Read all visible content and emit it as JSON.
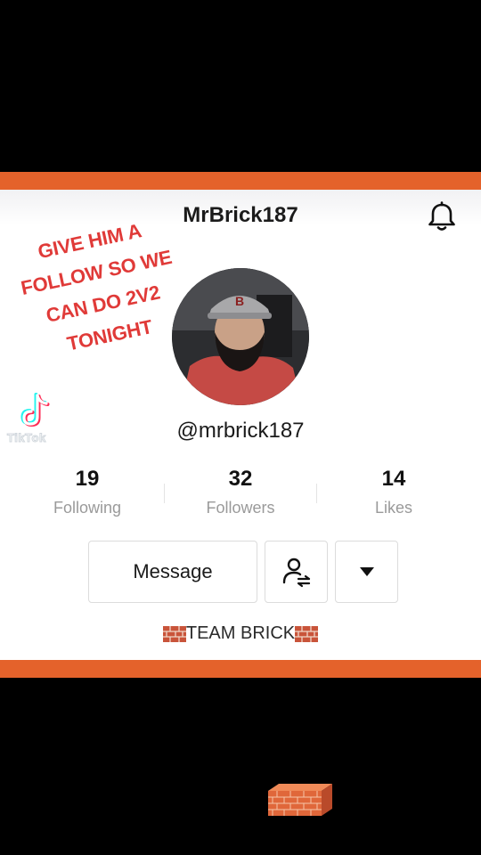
{
  "profile": {
    "username": "MrBrick187",
    "handle": "@mrbrick187",
    "bio": "TEAM BRICK"
  },
  "overlay": {
    "lines": [
      "GIVE HIM A",
      "FOLLOW SO WE",
      "CAN DO 2V2",
      "TONIGHT"
    ],
    "watermark": "TikTok"
  },
  "stats": [
    {
      "value": "19",
      "label": "Following"
    },
    {
      "value": "32",
      "label": "Followers"
    },
    {
      "value": "14",
      "label": "Likes"
    }
  ],
  "actions": {
    "message_label": "Message"
  },
  "icons": {
    "bell": "bell-icon",
    "follow": "user-swap-icon",
    "dropdown": "caret-down-icon",
    "brick": "brick-icon"
  },
  "colors": {
    "accent": "#e4622b",
    "overlay_text": "#e03a38"
  }
}
